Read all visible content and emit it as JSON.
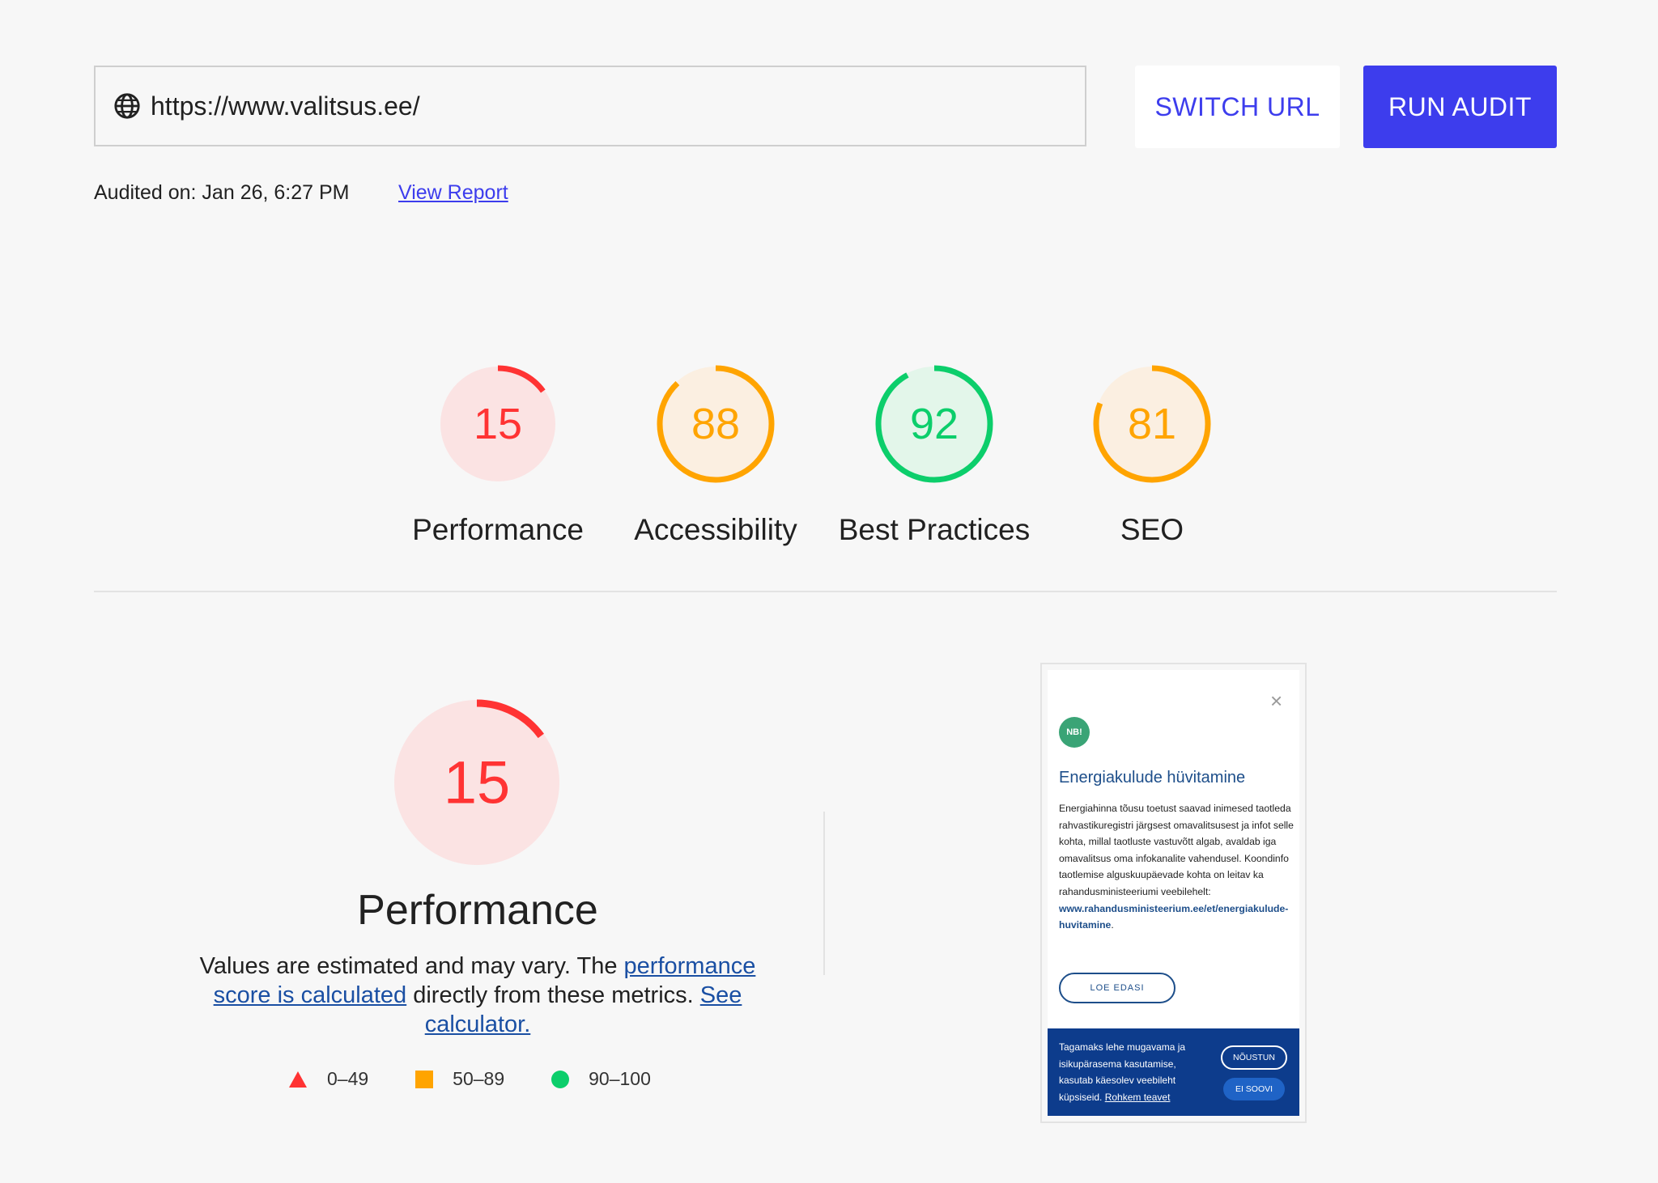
{
  "search": {
    "url": "https://www.valitsus.ee/"
  },
  "buttons": {
    "switch_url": "SWITCH URL",
    "run_audit": "RUN AUDIT"
  },
  "audit": {
    "audited_on": "Audited on: Jan 26, 6:27 PM",
    "view_report": "View Report"
  },
  "colors": {
    "fail": "#f33",
    "average": "#ffa400",
    "pass": "#0cce6b",
    "accent": "#3d3ded"
  },
  "categories": [
    {
      "label": "Performance",
      "score": 15,
      "rating": "fail"
    },
    {
      "label": "Accessibility",
      "score": 88,
      "rating": "average"
    },
    {
      "label": "Best Practices",
      "score": 92,
      "rating": "pass"
    },
    {
      "label": "SEO",
      "score": 81,
      "rating": "average"
    }
  ],
  "detail": {
    "score": 15,
    "rating": "fail",
    "title": "Performance",
    "desc_prefix": "Values are estimated and may vary. The ",
    "desc_link1": "performance score is calculated",
    "desc_middle": " directly from these metrics. ",
    "desc_link2": "See calculator."
  },
  "legend": [
    {
      "icon": "triangle-icon",
      "range": "0–49"
    },
    {
      "icon": "square-icon",
      "range": "50–89"
    },
    {
      "icon": "circle-icon",
      "range": "90–100"
    }
  ],
  "thumbnail": {
    "close": "×",
    "badge": "NB!",
    "heading": "Energiakulude hüvitamine",
    "body": "Energiahinna tõusu toetust saavad inimesed taotleda rahvastikuregistri järgsest omavalitsusest ja infot selle kohta, millal taotluste vastuvõtt algab, avaldab iga omavalitsus oma infokanalite vahendusel. Koondinfo taotlemise alguskuupäevade kohta on leitav ka rahandusministeeriumi veebilehelt: ",
    "body_link": "www.rahandusministeerium.ee/et/energiakulude-huvitamine",
    "body_end": ".",
    "read_more": "LOE EDASI",
    "cookie_text": "Tagamaks lehe mugavama ja isikupärasema kasutamise, kasutab käesolev veebileht küpsiseid. ",
    "cookie_more": "Rohkem teavet",
    "cookie_agree": "NÕUSTUN",
    "cookie_decline": "EI SOOVI"
  }
}
